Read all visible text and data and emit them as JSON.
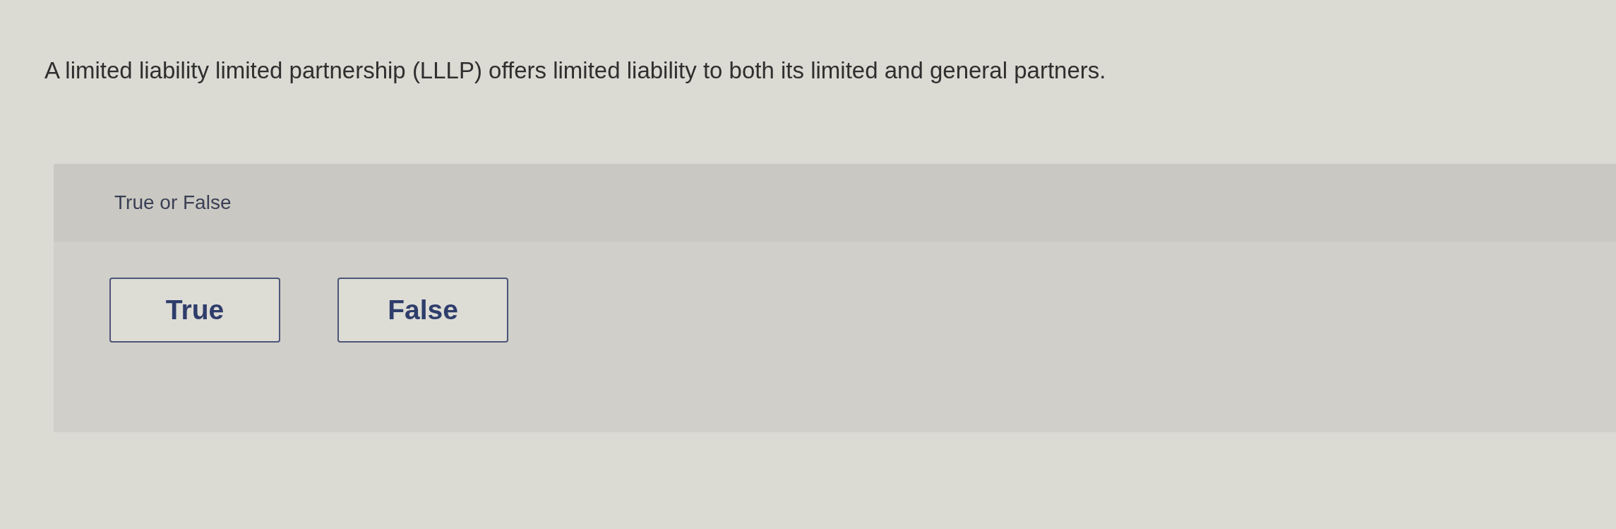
{
  "question": {
    "text": "A limited liability limited partnership (LLLP) offers limited liability to both its limited and general partners."
  },
  "answer_panel": {
    "prompt": "True or False",
    "options": [
      {
        "label": "True",
        "selected": false
      },
      {
        "label": "False",
        "selected": false
      }
    ]
  }
}
